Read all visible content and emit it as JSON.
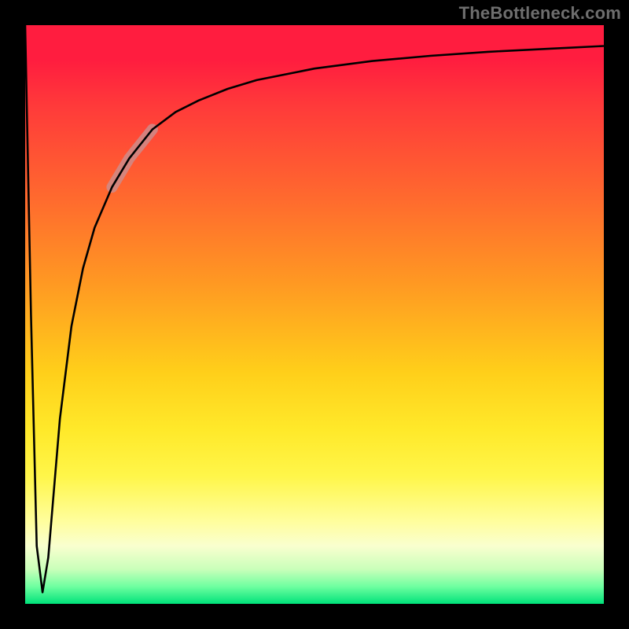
{
  "attribution": "TheBottleneck.com",
  "chart_data": {
    "type": "line",
    "title": "",
    "xlabel": "",
    "ylabel": "",
    "xlim": [
      0,
      100
    ],
    "ylim": [
      0,
      100
    ],
    "background_gradient": {
      "top": "#ff1d3f",
      "middle": "#ffe92a",
      "bottom": "#00e27a"
    },
    "series": [
      {
        "name": "main-curve",
        "x": [
          0,
          1,
          2,
          3,
          4,
          5,
          6,
          8,
          10,
          12,
          15,
          18,
          22,
          26,
          30,
          35,
          40,
          50,
          60,
          70,
          80,
          90,
          100
        ],
        "values": [
          100,
          50,
          10,
          2,
          8,
          20,
          32,
          48,
          58,
          65,
          72,
          77,
          82,
          85,
          87,
          89,
          90.5,
          92.5,
          93.8,
          94.7,
          95.4,
          95.9,
          96.4
        ]
      }
    ],
    "highlight_segment": {
      "series": "main-curve",
      "x_start": 15,
      "x_end": 22,
      "color": "#cc8e8e"
    }
  }
}
